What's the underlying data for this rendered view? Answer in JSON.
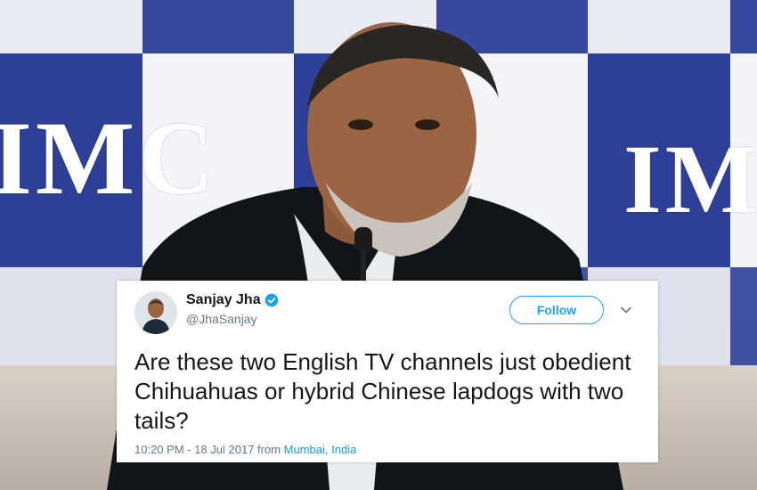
{
  "photo": {
    "banner_text_left": "IMC",
    "banner_text_right": "IM"
  },
  "tweet": {
    "author_name": "Sanjay Jha",
    "author_handle": "@JhaSanjay",
    "verified": true,
    "follow_label": "Follow",
    "text": "Are these two English TV channels just obedient Chihuahuas or hybrid Chinese lapdogs with two tails?",
    "timestamp": "10:20 PM - 18 Jul 2017",
    "from_label": "from",
    "location": "Mumbai, India"
  },
  "icons": {
    "verified": "verified-badge-icon",
    "menu": "chevron-down-icon"
  },
  "colors": {
    "twitter_blue": "#1da1f2",
    "link_blue": "#1b95e0",
    "text_dark": "#14171a",
    "text_muted": "#657786",
    "banner_blue": "#2e3f97"
  }
}
